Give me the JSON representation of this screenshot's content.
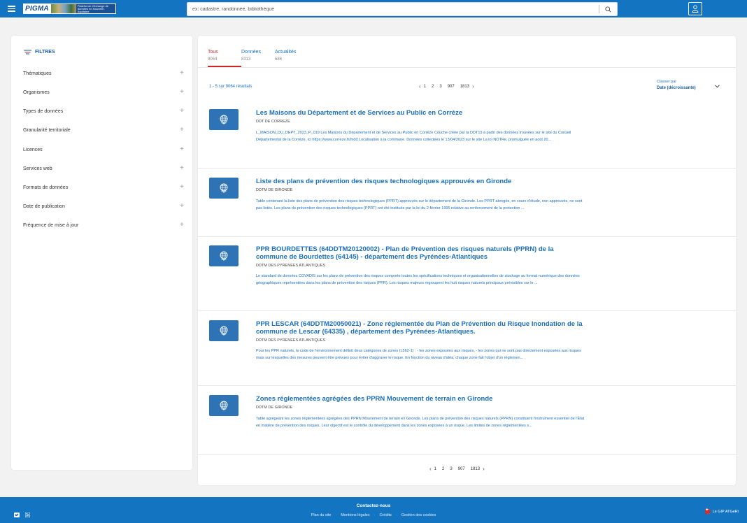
{
  "header": {
    "logo_text": "PIGMA",
    "logo_tagline": "Plateforme d'échange de données en Nouvelle-Aquitaine",
    "search_placeholder": "ex: cadastre, randonnée, bibliothèque"
  },
  "sidebar": {
    "title": "FILTRES",
    "items": [
      {
        "label": "Thématiques"
      },
      {
        "label": "Organismes"
      },
      {
        "label": "Types de données"
      },
      {
        "label": "Granularité territoriale"
      },
      {
        "label": "Licences"
      },
      {
        "label": "Services web"
      },
      {
        "label": "Formats de données"
      },
      {
        "label": "Date de publication"
      },
      {
        "label": "Fréquence de mise à jour"
      }
    ]
  },
  "tabs": [
    {
      "label": "Tous",
      "count": "9064"
    },
    {
      "label": "Données",
      "count": "8313"
    },
    {
      "label": "Actualités",
      "count": "586"
    }
  ],
  "results_summary": "1 - 5  sur 9064 résultats",
  "pagination": {
    "pages": [
      "1",
      "2",
      "3",
      "907",
      "1813"
    ]
  },
  "sort": {
    "label": "Classer par",
    "value": "Date (décroissante)"
  },
  "results": [
    {
      "title": "Les Maisons du Département et de Services au Public en Corrèze",
      "org": "DDT DE CORREZE",
      "desc": "L_MAISON_DU_DEPT_2023_P_019 Les Maisons du Département et de Services au Public en Corrèze Couche créée par la DDT19 à partir des données trouvées sur le site du Conseil Départemental de la Corrèze, ici https://www.correze.fr/mdd Localisation à la commune. Données collectées le 13/04/2023 sur le site La loi NOTRe, promulguée en août 20..."
    },
    {
      "title": "Liste des plans de prévention des risques technologiques approuvés en Gironde",
      "org": "DDTM DE GIRONDE",
      "desc": "Table contenant la liste des plans de prévention des risques technologiques (PPRT) approuvés sur le département de la Gironde. Les PPRT abrogés, en cours d'étude, non approuvés, ne sont pas listés. Les plans de prévention des risques technologiques (PPRT) ont été institués par la loi du 2 février 1995 relative au ren­forcement de la protection ..."
    },
    {
      "title": "PPR BOURDETTES (64DDTM20120002) - Plan de Prévention des risques naturels (PPRN) de la commune de Bourdettes (64145) - département des Pyrénées-Atlantiques",
      "org": "DDTM DES PYRENEES ATLANTIQUES",
      "desc": "Le standard de données COVADIS sur les plans de prévention des risques comporte toutes les spécifications techniques et organisationnelles de stockage au for­mat numérique des données géographiques représentées dans les plans de prévention des risques (PPR). Les risques majeurs regroupent les huit risques naturels principaux prévisibles sur le ..."
    },
    {
      "title": "PPR LESCAR (64DDTM20050021) - Zone réglementée du Plan de Prévention du Risque Inondation de la commune de Lescar (64335) , département des Pyrénées-Atlantiques.",
      "org": "DDTM DES PYRENEES ATLANTIQUES",
      "desc": "Pour les PPR naturels, le code de l'environnement définit deux catégories de zones (L562-1) : - les zones exposées aux risques, - les zones qui ne sont pas directe­ment exposées aux risques mais sur lesquelles des mesures peuvent être prévues pour éviter d'aggraver le risque. En fonction du niveau d'aléa, chaque zone fait l'objet d'un réglemen..."
    },
    {
      "title": "Zones réglementées agrégées des PPRN Mouvement de terrain en Gironde",
      "org": "DDTM DE GIRONDE",
      "desc": "Table agrégeant les zones réglementées agrégées des PPRN Mouvement de terrain en Gironde. Les plans de prévention des risques naturels (PPRN) constituent l'instrument essentiel de l'État en matière de prévention des risques. Leur objectif est le contrôle du développement dans les zones exposées à un risque. Les li­mites de zones réglementées s..."
    }
  ],
  "footer": {
    "contact": "Contactez-nous",
    "links": [
      "Plan du site",
      "Mentions légales",
      "Crédits",
      "Gestion des cookies"
    ],
    "gip": "Le GIP ATGeRi"
  },
  "colors": {
    "header_blue": "#1374c2",
    "link_blue": "#1a6fc0",
    "active_red": "#c62828",
    "thumb_blue": "#2f73b7"
  },
  "icons": {
    "menu": "hamburger-icon",
    "search": "search-icon",
    "user": "user-icon",
    "filters": "filter-icon",
    "thumbnail": "globe-icon",
    "expand": "plus-icon",
    "sort": "chevron-down-icon",
    "twitter": "twitter-icon",
    "rss": "rss-icon"
  }
}
